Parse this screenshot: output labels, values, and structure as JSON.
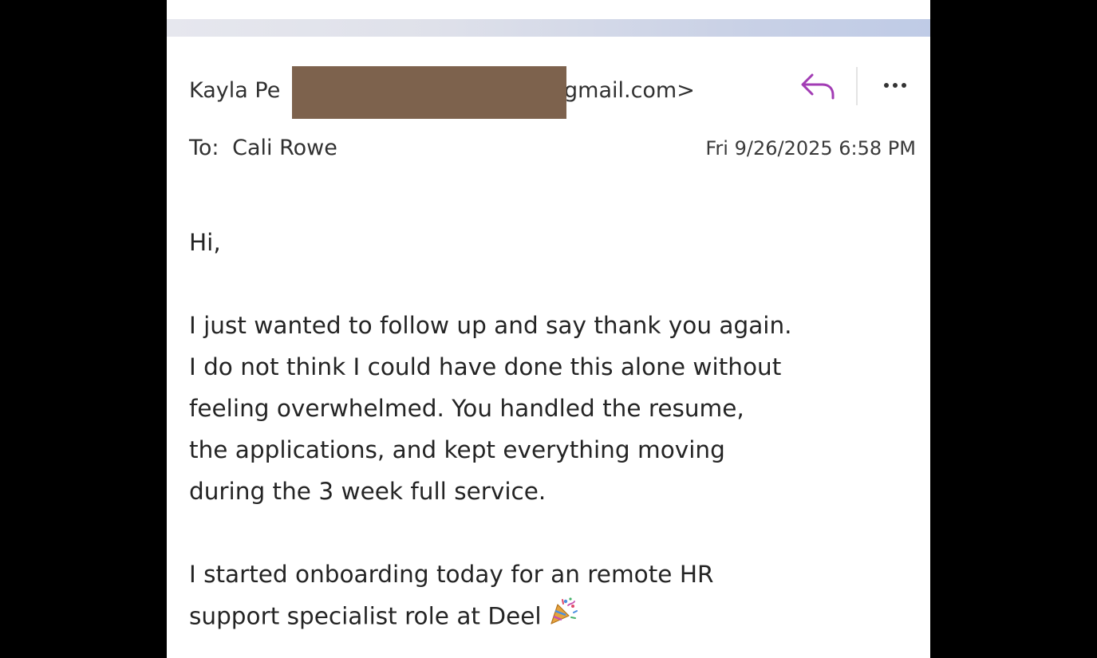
{
  "colors": {
    "accent": "#a23cb4",
    "redaction": "#7d624d",
    "text": "#242424"
  },
  "message": {
    "sender_visible_prefix": "Kayla Pe",
    "sender_visible_suffix": "gmail.com>",
    "to_label": "To:",
    "to_name": "Cali Rowe",
    "date": "Fri 9/26/2025 6:58 PM"
  },
  "actions": {
    "reply_icon": "reply-arrow-icon",
    "more_icon": "more-options-icon"
  },
  "body": {
    "greeting": "Hi,",
    "paragraph1_lines": [
      "I just wanted to follow up and say thank you again.",
      "I do not think I could have done this alone without",
      "feeling overwhelmed. You handled the resume,",
      "the applications, and kept everything moving",
      "during the 3 week full service."
    ],
    "paragraph2_lines": [
      "I started onboarding today for an remote HR",
      "support specialist role at Deel"
    ],
    "emoji_icon": "party-popper-icon"
  }
}
